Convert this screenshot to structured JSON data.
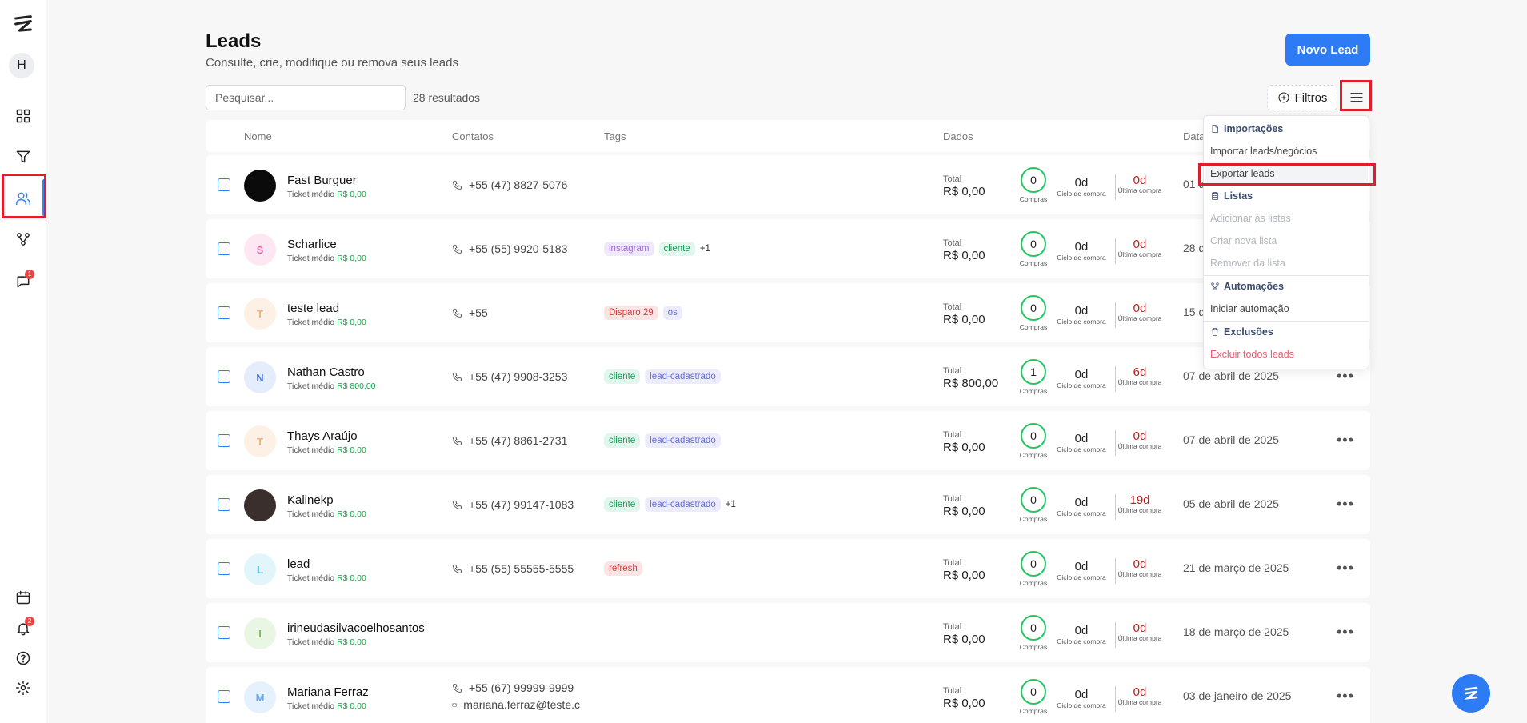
{
  "page": {
    "title": "Leads",
    "subtitle": "Consulte, crie, modifique ou remova seus leads",
    "new_button": "Novo Lead",
    "search_placeholder": "Pesquisar...",
    "results": "28 resultados",
    "filters": "Filtros"
  },
  "sidebar": {
    "avatar_letter": "H",
    "chat_badge": "1",
    "bell_badge": "2"
  },
  "table": {
    "headers": {
      "name": "Nome",
      "contacts": "Contatos",
      "tags": "Tags",
      "data": "Dados",
      "date": "Data"
    },
    "ticket_label": "Ticket médio",
    "total_label": "Total",
    "purchases_label": "Compras",
    "cycle_label": "Ciclo de compra",
    "last_label": "Última compra",
    "rows": [
      {
        "name": "Fast Burguer",
        "initial": "",
        "ticket": "R$ 0,00",
        "phone": "+55 (47) 8827-5076",
        "tags": [],
        "more": "",
        "total": "R$ 0,00",
        "purchases": "0",
        "cycle": "0d",
        "last": "0d",
        "date": "01 d"
      },
      {
        "name": "Scharlice",
        "initial": "S",
        "ticket": "R$ 0,00",
        "phone": "+55 (55) 9920-5183",
        "tags": [
          "instagram",
          "cliente"
        ],
        "more": "+1",
        "total": "R$ 0,00",
        "purchases": "0",
        "cycle": "0d",
        "last": "0d",
        "date": "28 d"
      },
      {
        "name": "teste lead",
        "initial": "T",
        "ticket": "R$ 0,00",
        "phone": "+55",
        "tags": [
          "Disparo 29",
          "os"
        ],
        "more": "",
        "total": "R$ 0,00",
        "purchases": "0",
        "cycle": "0d",
        "last": "0d",
        "date": "15 d"
      },
      {
        "name": "Nathan Castro",
        "initial": "N",
        "ticket": "R$ 800,00",
        "phone": "+55 (47) 9908-3253",
        "tags": [
          "cliente",
          "lead-cadastrado"
        ],
        "more": "",
        "total": "R$ 800,00",
        "purchases": "1",
        "cycle": "0d",
        "last": "6d",
        "date": "07 de abril de 2025"
      },
      {
        "name": "Thays Araújo",
        "initial": "T",
        "ticket": "R$ 0,00",
        "phone": "+55 (47) 8861-2731",
        "tags": [
          "cliente",
          "lead-cadastrado"
        ],
        "more": "",
        "total": "R$ 0,00",
        "purchases": "0",
        "cycle": "0d",
        "last": "0d",
        "date": "07 de abril de 2025"
      },
      {
        "name": "Kalinekp",
        "initial": "",
        "ticket": "R$ 0,00",
        "phone": "+55 (47) 99147-1083",
        "tags": [
          "cliente",
          "lead-cadastrado"
        ],
        "more": "+1",
        "total": "R$ 0,00",
        "purchases": "0",
        "cycle": "0d",
        "last": "19d",
        "date": "05 de abril de 2025"
      },
      {
        "name": "lead",
        "initial": "L",
        "ticket": "R$ 0,00",
        "phone": "+55 (55) 55555-5555",
        "tags": [
          "refresh"
        ],
        "more": "",
        "total": "R$ 0,00",
        "purchases": "0",
        "cycle": "0d",
        "last": "0d",
        "date": "21 de março de 2025"
      },
      {
        "name": "irineudasilvacoelhosantos",
        "initial": "I",
        "ticket": "R$ 0,00",
        "phone": "",
        "tags": [],
        "more": "",
        "total": "R$ 0,00",
        "purchases": "0",
        "cycle": "0d",
        "last": "0d",
        "date": "18 de março de 2025"
      },
      {
        "name": "Mariana Ferraz",
        "initial": "M",
        "ticket": "R$ 0,00",
        "phone": "+55 (67) 99999-9999",
        "email": "mariana.ferraz@teste.c",
        "tags": [],
        "more": "",
        "total": "R$ 0,00",
        "purchases": "0",
        "cycle": "0d",
        "last": "0d",
        "date": "03 de janeiro de 2025"
      }
    ]
  },
  "menu": {
    "imports": "Importações",
    "import_item": "Importar leads/negócios",
    "export_item": "Exportar leads",
    "lists": "Listas",
    "add_lists": "Adicionar às listas",
    "create_list": "Criar nova lista",
    "remove_list": "Remover da lista",
    "automations": "Automações",
    "start_automation": "Iniciar automação",
    "deletions": "Exclusões",
    "delete_all": "Excluir todos leads"
  }
}
